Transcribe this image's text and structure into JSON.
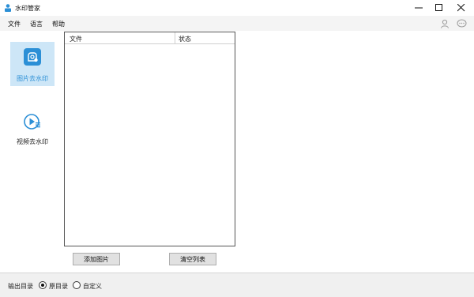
{
  "window": {
    "title": "水印管家",
    "app_icon": "user-stamp-icon",
    "controls": [
      "minimize-icon",
      "maximize-icon",
      "close-icon"
    ]
  },
  "menu": {
    "items": [
      {
        "label": "文件"
      },
      {
        "label": "语言"
      },
      {
        "label": "帮助"
      }
    ],
    "right_icons": [
      "user-icon",
      "chat-icon"
    ]
  },
  "sidebar": {
    "items": [
      {
        "label": "图片去水印",
        "icon": "image-remove-watermark-icon",
        "active": true
      },
      {
        "label": "视频去水印",
        "icon": "video-remove-watermark-icon",
        "active": false
      }
    ]
  },
  "file_list": {
    "columns": [
      "文件",
      "状态"
    ],
    "rows": []
  },
  "actions": {
    "add_image": "添加图片",
    "clear_list": "清空列表"
  },
  "footer": {
    "output_label": "输出目录",
    "options": [
      {
        "label": "原目录",
        "checked": true
      },
      {
        "label": "自定义",
        "checked": false
      }
    ]
  },
  "colors": {
    "accent": "#2b8fd6",
    "sidebar_active_bg": "#cde6f7",
    "menubar_bg": "#f4f4f4",
    "footer_bg": "#f0f0f0"
  }
}
